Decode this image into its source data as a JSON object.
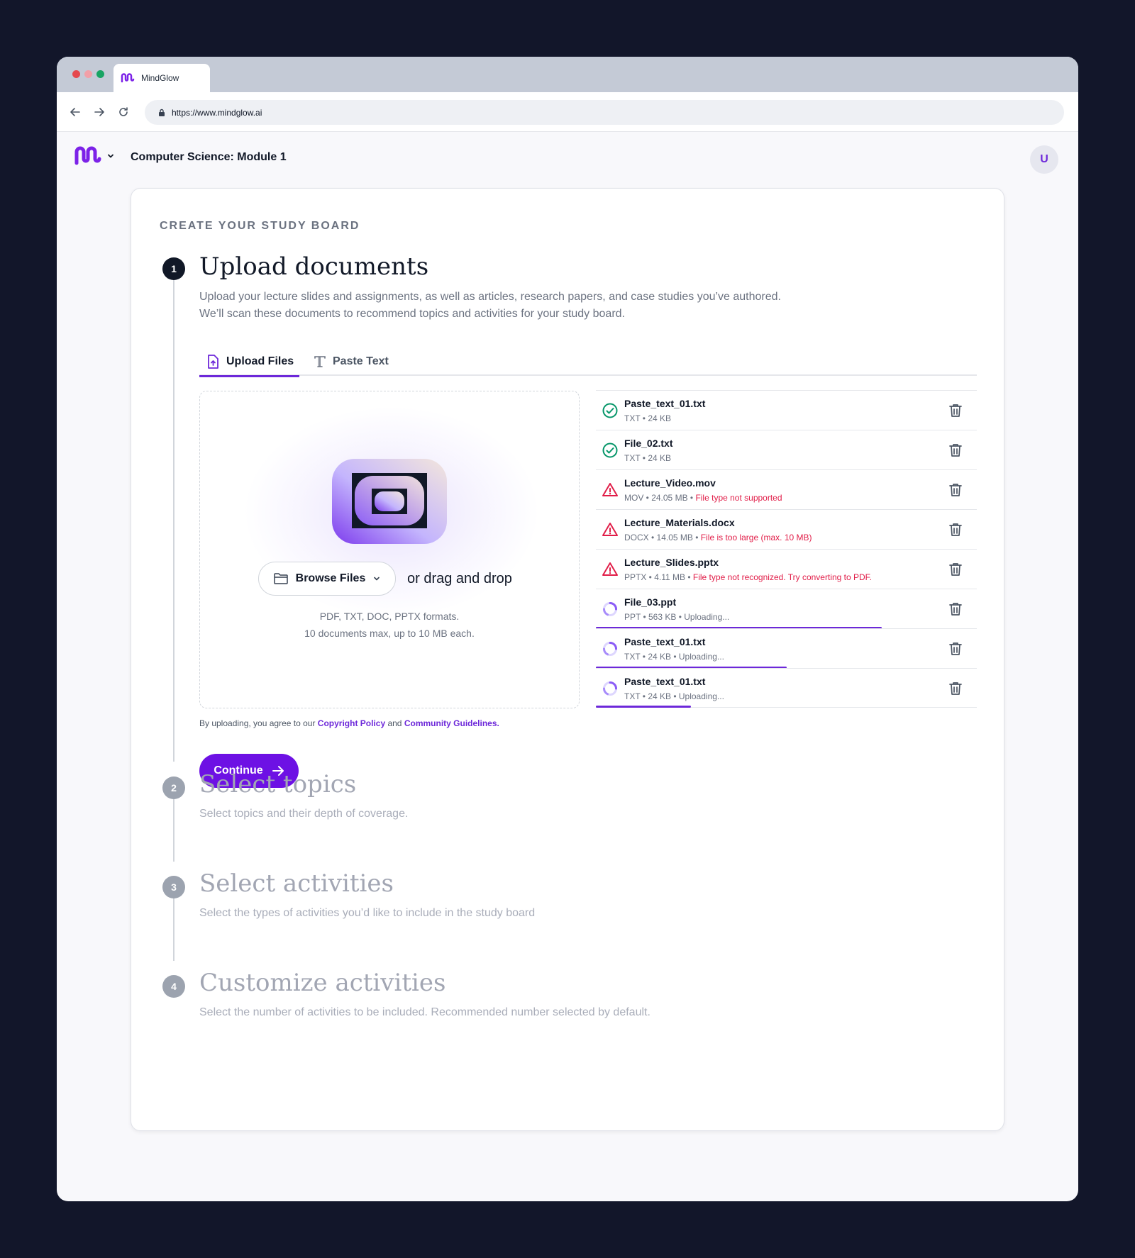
{
  "browser": {
    "tab_title": "MindGlow",
    "url": "https://www.mindglow.ai"
  },
  "app": {
    "title": "Computer Science: Module 1",
    "avatar_initial": "U"
  },
  "board": {
    "eyebrow": "CREATE YOUR STUDY BOARD",
    "steps": [
      {
        "number": "1",
        "title": "Upload documents",
        "desc_line1": "Upload your lecture slides and assignments, as well as articles, research papers, and case studies you’ve authored.",
        "desc_line2": "We’ll scan these documents to recommend topics and activities for your study board."
      },
      {
        "number": "2",
        "title": "Select topics",
        "desc": "Select topics and their depth of coverage."
      },
      {
        "number": "3",
        "title": "Select activities",
        "desc": "Select the types of activities you’d like to include in the study board"
      },
      {
        "number": "4",
        "title": "Customize activities",
        "desc": "Select the number of activities to be included. Recommended number selected by default."
      }
    ]
  },
  "tabs": [
    {
      "label": "Upload Files",
      "icon": "file-upload-icon",
      "active": true
    },
    {
      "label": "Paste Text",
      "icon": "text-icon",
      "active": false
    }
  ],
  "dropzone": {
    "browse_label": "Browse Files",
    "drag_text": "or drag and drop",
    "formats_line1": "PDF, TXT, DOC, PPTX formats.",
    "formats_line2": "10 documents max, up to 10 MB each."
  },
  "files": [
    {
      "name": "Paste_text_01.txt",
      "meta": "TXT • 24 KB",
      "error": "",
      "status": "success",
      "progress": 1
    },
    {
      "name": "File_02.txt",
      "meta": "TXT • 24 KB",
      "error": "",
      "status": "success",
      "progress": 1
    },
    {
      "name": "Lecture_Video.mov",
      "meta": "MOV • 24.05 MB • ",
      "error": "File type not supported",
      "status": "error",
      "progress": 0
    },
    {
      "name": "Lecture_Materials.docx",
      "meta": "DOCX • 14.05 MB • ",
      "error": "File is too large (max. 10 MB)",
      "status": "error",
      "progress": 0
    },
    {
      "name": "Lecture_Slides.pptx",
      "meta": "PPTX • 4.11 MB • ",
      "error": "File type not recognized. Try converting to PDF.",
      "status": "error",
      "progress": 0
    },
    {
      "name": "File_03.ppt",
      "meta": "PPT • 563 KB • Uploading...",
      "error": "",
      "status": "uploading",
      "progress": 0.75
    },
    {
      "name": "Paste_text_01.txt",
      "meta": "TXT • 24 KB • Uploading...",
      "error": "",
      "status": "uploading",
      "progress": 0.5
    },
    {
      "name": "Paste_text_01.txt",
      "meta": "TXT • 24 KB • Uploading...",
      "error": "",
      "status": "uploading",
      "progress": 0.25
    }
  ],
  "legal": {
    "prefix": "By uploading, you agree to our ",
    "copyright": "Copyright Policy",
    "and": " and ",
    "guidelines": "Community Guidelines."
  },
  "continue_label": "Continue",
  "colors": {
    "accent": "#6d28d9",
    "success": "#059669",
    "error": "#e11d48",
    "background": "#12162a"
  }
}
